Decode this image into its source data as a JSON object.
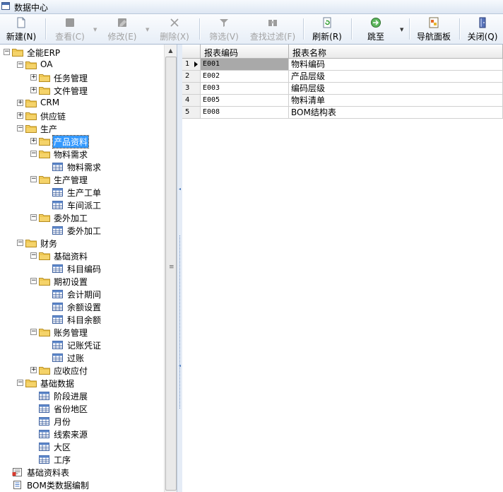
{
  "window": {
    "title": "数据中心"
  },
  "toolbar": {
    "buttons": [
      {
        "id": "new",
        "label": "新建",
        "key": "(N)",
        "enabled": true
      },
      {
        "id": "view",
        "label": "查看",
        "key": "(C)",
        "enabled": false
      },
      {
        "id": "edit",
        "label": "修改",
        "key": "(E)",
        "enabled": false
      },
      {
        "id": "delete",
        "label": "删除",
        "key": "(X)",
        "enabled": false
      },
      {
        "id": "filter",
        "label": "筛选",
        "key": "(V)",
        "enabled": false
      },
      {
        "id": "find-filter",
        "label": "查找过滤",
        "key": "(F)",
        "enabled": false
      },
      {
        "id": "refresh",
        "label": "刷新",
        "key": "(R)",
        "enabled": true
      },
      {
        "id": "jump",
        "label": "跳至",
        "key": "",
        "enabled": true
      },
      {
        "id": "nav-panel",
        "label": "导航面板",
        "key": "",
        "enabled": true
      },
      {
        "id": "close",
        "label": "关闭",
        "key": "(Q)",
        "enabled": true
      }
    ]
  },
  "tree": {
    "nodes": [
      {
        "label": "全能ERP",
        "type": "folder",
        "state": "expanded"
      },
      {
        "label": "OA",
        "type": "folder",
        "state": "expanded"
      },
      {
        "label": "任务管理",
        "type": "folder",
        "state": "collapsed"
      },
      {
        "label": "文件管理",
        "type": "folder",
        "state": "collapsed"
      },
      {
        "label": "CRM",
        "type": "folder",
        "state": "collapsed"
      },
      {
        "label": "供应链",
        "type": "folder",
        "state": "collapsed"
      },
      {
        "label": "生产",
        "type": "folder",
        "state": "expanded"
      },
      {
        "label": "产品资料",
        "type": "folder",
        "state": "collapsed",
        "selected": true
      },
      {
        "label": "物料需求",
        "type": "folder",
        "state": "expanded"
      },
      {
        "label": "物料需求",
        "type": "table"
      },
      {
        "label": "生产管理",
        "type": "folder",
        "state": "expanded"
      },
      {
        "label": "生产工单",
        "type": "table"
      },
      {
        "label": "车间派工",
        "type": "table"
      },
      {
        "label": "委外加工",
        "type": "folder",
        "state": "expanded"
      },
      {
        "label": "委外加工",
        "type": "table"
      },
      {
        "label": "财务",
        "type": "folder",
        "state": "expanded"
      },
      {
        "label": "基础资料",
        "type": "folder",
        "state": "expanded"
      },
      {
        "label": "科目编码",
        "type": "table"
      },
      {
        "label": "期初设置",
        "type": "folder",
        "state": "expanded"
      },
      {
        "label": "会计期间",
        "type": "table"
      },
      {
        "label": "余额设置",
        "type": "table"
      },
      {
        "label": "科目余额",
        "type": "table"
      },
      {
        "label": "账务管理",
        "type": "folder",
        "state": "expanded"
      },
      {
        "label": "记账凭证",
        "type": "table"
      },
      {
        "label": "过账",
        "type": "table"
      },
      {
        "label": "应收应付",
        "type": "folder",
        "state": "collapsed"
      },
      {
        "label": "基础数据",
        "type": "folder",
        "state": "expanded"
      },
      {
        "label": "阶段进展",
        "type": "table"
      },
      {
        "label": "省份地区",
        "type": "table"
      },
      {
        "label": "月份",
        "type": "table"
      },
      {
        "label": "线索来源",
        "type": "table"
      },
      {
        "label": "大区",
        "type": "table"
      },
      {
        "label": "工序",
        "type": "table"
      },
      {
        "label": "基础资料表",
        "type": "report"
      },
      {
        "label": "BOM类数据编制",
        "type": "doc"
      }
    ]
  },
  "grid": {
    "columns": [
      "报表编码",
      "报表名称"
    ],
    "rows": [
      {
        "num": "1",
        "code": "E001",
        "name": "物料编码",
        "current": true
      },
      {
        "num": "2",
        "code": "E002",
        "name": "产品层级"
      },
      {
        "num": "3",
        "code": "E003",
        "name": "编码层级"
      },
      {
        "num": "4",
        "code": "E005",
        "name": "物料清单"
      },
      {
        "num": "5",
        "code": "E008",
        "name": "BOM结构表"
      }
    ]
  },
  "colors": {
    "selection": "#3399ff",
    "folder": "#f5d36a",
    "toolbar_bg": "#e7eef7"
  }
}
